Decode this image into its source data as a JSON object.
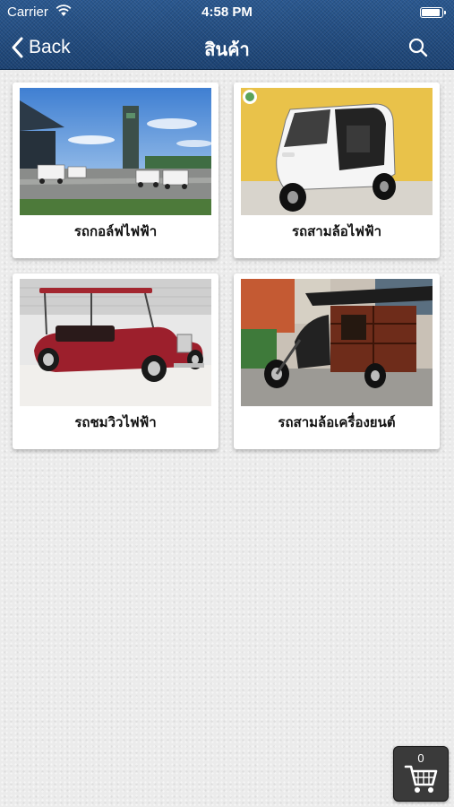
{
  "status_bar": {
    "carrier": "Carrier",
    "time": "4:58 PM",
    "battery_level": 1.0
  },
  "nav": {
    "back_label": "Back",
    "title": "สินค้า",
    "search_icon": "search-icon"
  },
  "products": [
    {
      "label": "รถกอล์ฟไฟฟ้า",
      "image": "golf-cart-photo"
    },
    {
      "label": "รถสามล้อไฟฟ้า",
      "image": "electric-tricycle-photo"
    },
    {
      "label": "รถชมวิวไฟฟ้า",
      "image": "sightseeing-car-photo"
    },
    {
      "label": "รถสามล้อเครื่องยนต์",
      "image": "motor-tricycle-photo"
    }
  ],
  "cart": {
    "count": "0",
    "icon": "cart-icon"
  },
  "colors": {
    "header": "#1f4a7e",
    "background": "#ebebeb",
    "cart_button": "#3a3a3a"
  }
}
